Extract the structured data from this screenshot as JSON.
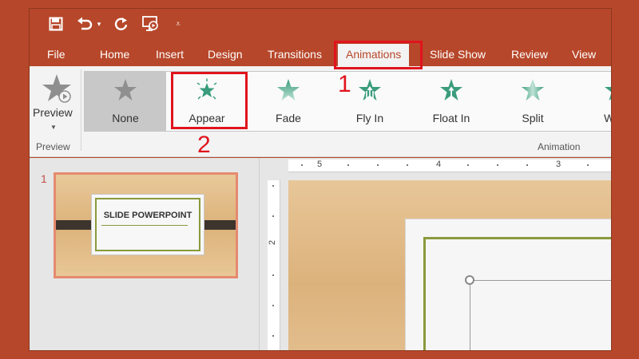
{
  "tabs": {
    "file": "File",
    "home": "Home",
    "insert": "Insert",
    "design": "Design",
    "transitions": "Transitions",
    "animations": "Animations",
    "slide_show": "Slide Show",
    "review": "Review",
    "view": "View"
  },
  "ribbon": {
    "preview_label": "Preview",
    "preview_group": "Preview",
    "animation_group": "Animation",
    "effects": [
      "None",
      "Appear",
      "Fade",
      "Fly In",
      "Float In",
      "Split",
      "W"
    ],
    "selected_effect": "None"
  },
  "annotations": {
    "step1": "1",
    "step2": "2"
  },
  "ruler": {
    "horizontal": [
      "5",
      "4",
      "3"
    ],
    "vertical": [
      "2"
    ]
  },
  "slides": {
    "thumb_number": "1",
    "thumb_title": "SLIDE POWERPOINT"
  },
  "colors": {
    "brand": "#b7472a",
    "highlight": "#e0141c",
    "star_teal": "#3a9c7c"
  }
}
